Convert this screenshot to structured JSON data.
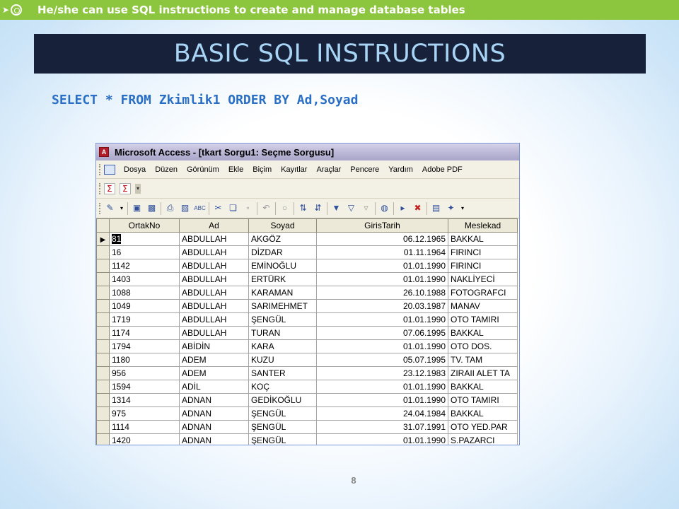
{
  "banner": {
    "text": "He/she can use SQL instructions to create and manage database tables",
    "color": "#8cc63e"
  },
  "title": "BASIC SQL INSTRUCTIONS",
  "sql_statement": "SELECT * FROM Zkimlik1 ORDER BY Ad,Soyad",
  "page_number": "8",
  "access_window": {
    "title": "Microsoft Access - [tkart Sorgu1: Seçme Sorgusu]",
    "menu": [
      "Dosya",
      "Düzen",
      "Görünüm",
      "Ekle",
      "Biçim",
      "Kayıtlar",
      "Araçlar",
      "Pencere",
      "Yardım",
      "Adobe PDF"
    ],
    "columns": [
      "OrtakNo",
      "Ad",
      "Soyad",
      "GirisTarih",
      "Meslekad"
    ],
    "rows": [
      [
        "81",
        "ABDULLAH",
        "AKGÖZ",
        "06.12.1965",
        "BAKKAL"
      ],
      [
        "16",
        "ABDULLAH",
        "DİZDAR",
        "01.11.1964",
        "FIRINCI"
      ],
      [
        "1142",
        "ABDULLAH",
        "EMİNOĞLU",
        "01.01.1990",
        "FIRINCI"
      ],
      [
        "1403",
        "ABDULLAH",
        "ERTÜRK",
        "01.01.1990",
        "NAKLİYECİ"
      ],
      [
        "1088",
        "ABDULLAH",
        "KARAMAN",
        "26.10.1988",
        "FOTOGRAFCI"
      ],
      [
        "1049",
        "ABDULLAH",
        "SARIMEHMET",
        "20.03.1987",
        "MANAV"
      ],
      [
        "1719",
        "ABDULLAH",
        "ŞENGÜL",
        "01.01.1990",
        "OTO TAMIRI"
      ],
      [
        "1174",
        "ABDULLAH",
        "TURAN",
        "07.06.1995",
        "BAKKAL"
      ],
      [
        "1794",
        "ABİDİN",
        "KARA",
        "01.01.1990",
        "OTO DOS."
      ],
      [
        "1180",
        "ADEM",
        "KUZU",
        "05.07.1995",
        "TV. TAM"
      ],
      [
        "956",
        "ADEM",
        "SANTER",
        "23.12.1983",
        "ZIRAII ALET TA"
      ],
      [
        "1594",
        "ADİL",
        "KOÇ",
        "01.01.1990",
        "BAKKAL"
      ],
      [
        "1314",
        "ADNAN",
        "GEDİKOĞLU",
        "01.01.1990",
        "OTO TAMIRI"
      ],
      [
        "975",
        "ADNAN",
        "ŞENGÜL",
        "24.04.1984",
        "BAKKAL"
      ],
      [
        "1114",
        "ADNAN",
        "ŞENGÜL",
        "31.07.1991",
        "OTO YED.PAR"
      ],
      [
        "1420",
        "ADNAN",
        "ŞENGÜL",
        "01.01.1990",
        "S.PAZARCI"
      ]
    ]
  }
}
